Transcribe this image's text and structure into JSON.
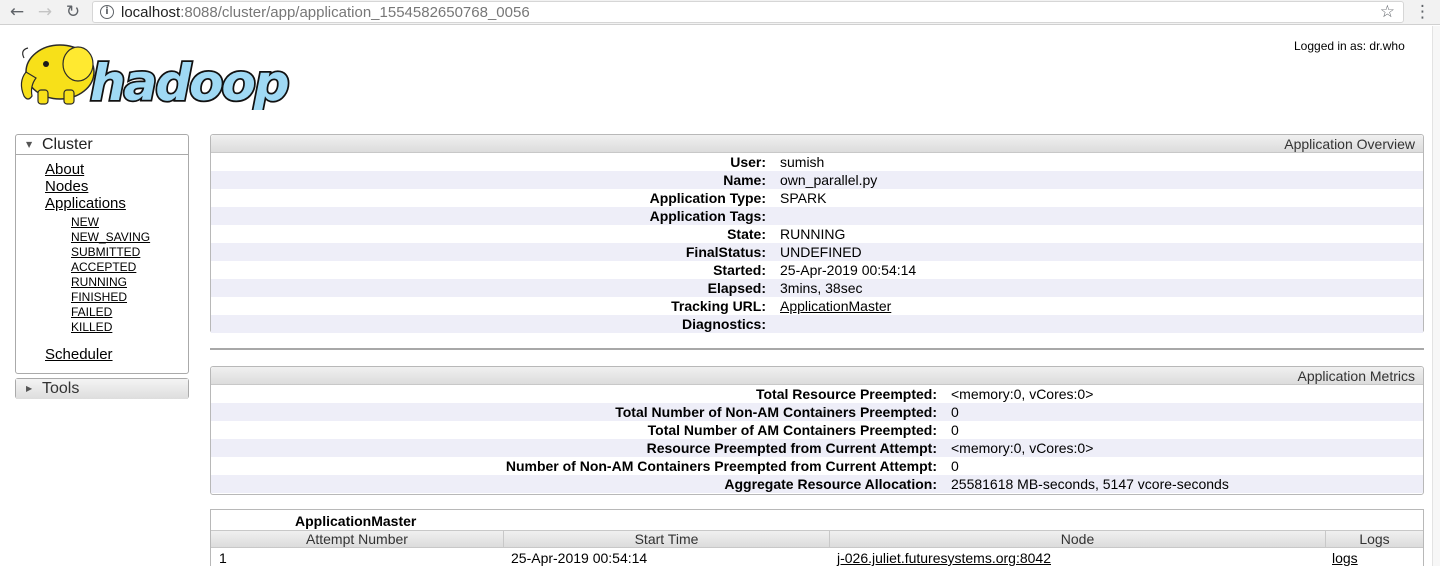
{
  "browser": {
    "url_host": "localhost",
    "url_rest": ":8088/cluster/app/application_1554582650768_0056",
    "icons": [
      "back-arrow-icon",
      "forward-arrow-icon",
      "reload-icon",
      "info-icon",
      "star-icon",
      "menu-dots-icon"
    ]
  },
  "header": {
    "logo_text": "hadoop",
    "logged_in": "Logged in as: dr.who"
  },
  "nav": {
    "cluster_label": "Cluster",
    "about": "About",
    "nodes": "Nodes",
    "applications": "Applications",
    "states": [
      "NEW",
      "NEW_SAVING",
      "SUBMITTED",
      "ACCEPTED",
      "RUNNING",
      "FINISHED",
      "FAILED",
      "KILLED"
    ],
    "scheduler": "Scheduler",
    "tools_label": "Tools"
  },
  "overview": {
    "title": "Application Overview",
    "rows": [
      {
        "key": "User:",
        "value": "sumish"
      },
      {
        "key": "Name:",
        "value": "own_parallel.py"
      },
      {
        "key": "Application Type:",
        "value": "SPARK"
      },
      {
        "key": "Application Tags:",
        "value": ""
      },
      {
        "key": "State:",
        "value": "RUNNING"
      },
      {
        "key": "FinalStatus:",
        "value": "UNDEFINED"
      },
      {
        "key": "Started:",
        "value": "25-Apr-2019 00:54:14"
      },
      {
        "key": "Elapsed:",
        "value": "3mins, 38sec"
      },
      {
        "key": "Tracking URL:",
        "value": "ApplicationMaster"
      },
      {
        "key": "Diagnostics:",
        "value": ""
      }
    ]
  },
  "metrics": {
    "title": "Application Metrics",
    "rows": [
      {
        "key": "Total Resource Preempted:",
        "value": "<memory:0, vCores:0>"
      },
      {
        "key": "Total Number of Non-AM Containers Preempted:",
        "value": "0"
      },
      {
        "key": "Total Number of AM Containers Preempted:",
        "value": "0"
      },
      {
        "key": "Resource Preempted from Current Attempt:",
        "value": "<memory:0, vCores:0>"
      },
      {
        "key": "Number of Non-AM Containers Preempted from Current Attempt:",
        "value": "0"
      },
      {
        "key": "Aggregate Resource Allocation:",
        "value": "25581618 MB-seconds, 5147 vcore-seconds"
      }
    ]
  },
  "attempts": {
    "title": "ApplicationMaster",
    "columns": [
      "Attempt Number",
      "Start Time",
      "Node",
      "Logs"
    ],
    "rows": [
      {
        "attempt": "1",
        "start": "25-Apr-2019 00:54:14",
        "node": "j-026.juliet.futuresystems.org:8042",
        "logs": "logs"
      }
    ]
  }
}
